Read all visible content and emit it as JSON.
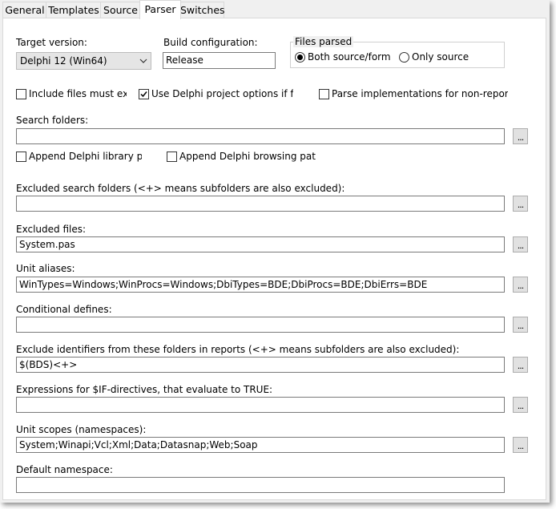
{
  "tabs": [
    {
      "label": "General"
    },
    {
      "label": "Templates"
    },
    {
      "label": "Source"
    },
    {
      "label": "Parser"
    },
    {
      "label": "Switches"
    }
  ],
  "target_version": {
    "label": "Target version:",
    "value": "Delphi 12 (Win64)"
  },
  "build_config": {
    "label": "Build configuration:",
    "value": "Release"
  },
  "files_parsed": {
    "label": "Files parsed",
    "options": [
      {
        "label": "Both source/form",
        "selected": true
      },
      {
        "label": "Only source",
        "selected": false
      }
    ]
  },
  "checkboxes_row1": [
    {
      "label": "Include files must exist",
      "checked": false
    },
    {
      "label": "Use Delphi project options if found",
      "checked": true
    },
    {
      "label": "Parse implementations for non-reported",
      "checked": false
    }
  ],
  "checkboxes_row2": [
    {
      "label": "Append Delphi library path",
      "checked": false
    },
    {
      "label": "Append Delphi browsing path",
      "checked": false
    }
  ],
  "browse_label": "...",
  "sections": {
    "search_folders": {
      "label": "Search folders:",
      "value": ""
    },
    "excluded_search_folders": {
      "label": "Excluded search folders (<+> means subfolders are also excluded):",
      "value": ""
    },
    "excluded_files": {
      "label": "Excluded files:",
      "value": "System.pas"
    },
    "unit_aliases": {
      "label": "Unit aliases:",
      "value": "WinTypes=Windows;WinProcs=Windows;DbiTypes=BDE;DbiProcs=BDE;DbiErrs=BDE"
    },
    "conditional_defines": {
      "label": "Conditional defines:",
      "value": ""
    },
    "exclude_identifiers": {
      "label": "Exclude identifiers from these folders in reports (<+> means subfolders are also excluded):",
      "value": "$(BDS)<+>"
    },
    "if_expressions": {
      "label": "Expressions for $IF-directives, that evaluate to TRUE:",
      "value": ""
    },
    "unit_scopes": {
      "label": "Unit scopes (namespaces):",
      "value": "System;Winapi;Vcl;Xml;Data;Datasnap;Web;Soap"
    },
    "default_namespace": {
      "label": "Default namespace:",
      "value": ""
    }
  }
}
